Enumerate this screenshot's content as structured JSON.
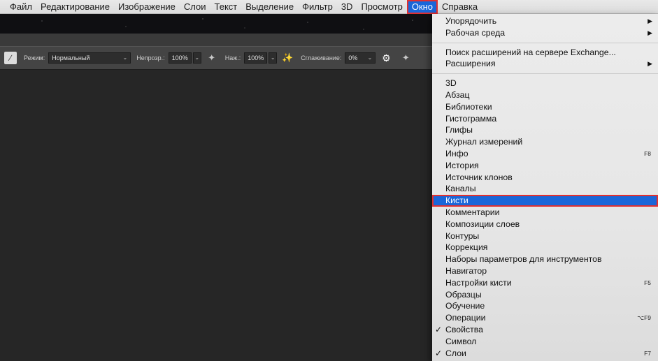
{
  "menubar": {
    "items": [
      "Файл",
      "Редактирование",
      "Изображение",
      "Слои",
      "Текст",
      "Выделение",
      "Фильтр",
      "3D",
      "Просмотр",
      "Окно",
      "Справка"
    ],
    "active_index": 9
  },
  "options_bar": {
    "mode_label": "Режим:",
    "mode_value": "Нормальный",
    "opacity_label": "Непрозр.:",
    "opacity_value": "100%",
    "flow_label": "Наж.:",
    "flow_value": "100%",
    "smoothing_label": "Сглаживание:",
    "smoothing_value": "0%",
    "icons": [
      "brush-preset-icon",
      "pressure-opacity-icon",
      "airbrush-icon",
      "gear-icon",
      "pressure-size-icon"
    ]
  },
  "window_menu": {
    "group1": [
      {
        "label": "Упорядочить",
        "submenu": true
      },
      {
        "label": "Рабочая среда",
        "submenu": true
      }
    ],
    "group2": [
      {
        "label": "Поиск расширений на сервере Exchange...",
        "submenu": false
      },
      {
        "label": "Расширения",
        "submenu": true
      }
    ],
    "group3": [
      {
        "label": "3D",
        "shortcut": "",
        "checked": false
      },
      {
        "label": "Абзац",
        "shortcut": "",
        "checked": false
      },
      {
        "label": "Библиотеки",
        "shortcut": "",
        "checked": false
      },
      {
        "label": "Гистограмма",
        "shortcut": "",
        "checked": false
      },
      {
        "label": "Глифы",
        "shortcut": "",
        "checked": false
      },
      {
        "label": "Журнал измерений",
        "shortcut": "",
        "checked": false
      },
      {
        "label": "Инфо",
        "shortcut": "F8",
        "checked": false
      },
      {
        "label": "История",
        "shortcut": "",
        "checked": false
      },
      {
        "label": "Источник клонов",
        "shortcut": "",
        "checked": false
      },
      {
        "label": "Каналы",
        "shortcut": "",
        "checked": false
      },
      {
        "label": "Кисти",
        "shortcut": "",
        "checked": false,
        "selected": true
      },
      {
        "label": "Комментарии",
        "shortcut": "",
        "checked": false
      },
      {
        "label": "Композиции слоев",
        "shortcut": "",
        "checked": false
      },
      {
        "label": "Контуры",
        "shortcut": "",
        "checked": false
      },
      {
        "label": "Коррекция",
        "shortcut": "",
        "checked": false
      },
      {
        "label": "Наборы параметров для инструментов",
        "shortcut": "",
        "checked": false
      },
      {
        "label": "Навигатор",
        "shortcut": "",
        "checked": false
      },
      {
        "label": "Настройки кисти",
        "shortcut": "F5",
        "checked": false
      },
      {
        "label": "Образцы",
        "shortcut": "",
        "checked": false
      },
      {
        "label": "Обучение",
        "shortcut": "",
        "checked": false
      },
      {
        "label": "Операции",
        "shortcut": "⌥F9",
        "checked": false
      },
      {
        "label": "Свойства",
        "shortcut": "",
        "checked": true
      },
      {
        "label": "Символ",
        "shortcut": "",
        "checked": false
      },
      {
        "label": "Слои",
        "shortcut": "F7",
        "checked": true
      }
    ]
  },
  "colors": {
    "highlight": "#1a66d9",
    "annotation_outline": "#e03030",
    "canvas": "#262626"
  }
}
